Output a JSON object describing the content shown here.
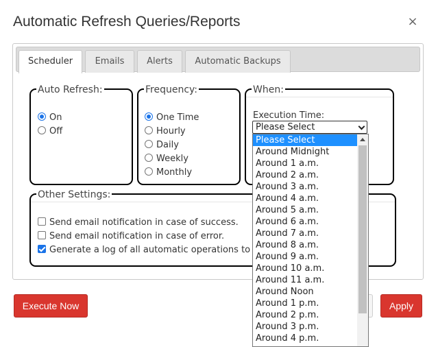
{
  "dialog": {
    "title": "Automatic Refresh Queries/Reports",
    "close_glyph": "×"
  },
  "tabs": [
    "Scheduler",
    "Emails",
    "Alerts",
    "Automatic Backups"
  ],
  "auto_refresh": {
    "legend": "Auto Refresh:",
    "options": [
      {
        "label": "On",
        "checked": true
      },
      {
        "label": "Off",
        "checked": false
      }
    ]
  },
  "frequency": {
    "legend": "Frequency:",
    "options": [
      {
        "label": "One Time",
        "checked": true
      },
      {
        "label": "Hourly",
        "checked": false
      },
      {
        "label": "Daily",
        "checked": false
      },
      {
        "label": "Weekly",
        "checked": false
      },
      {
        "label": "Monthly",
        "checked": false
      }
    ]
  },
  "when": {
    "legend": "When:",
    "execution_label": "Execution Time:",
    "selected_value": "Please Select",
    "options": [
      "Please Select",
      "Around Midnight",
      "Around 1 a.m.",
      "Around 2 a.m.",
      "Around 3 a.m.",
      "Around 4 a.m.",
      "Around 5 a.m.",
      "Around 6 a.m.",
      "Around 7 a.m.",
      "Around 8 a.m.",
      "Around 9 a.m.",
      "Around 10 a.m.",
      "Around 11 a.m.",
      "Around Noon",
      "Around 1 p.m.",
      "Around 2 p.m.",
      "Around 3 p.m.",
      "Around 4 p.m."
    ]
  },
  "other_settings": {
    "legend": "Other Settings:",
    "options": [
      {
        "label": "Send email notification in case of success.",
        "checked": false
      },
      {
        "label": "Send email notification in case of error.",
        "checked": false
      },
      {
        "label": "Generate a log of all automatic operations to",
        "checked": true
      }
    ]
  },
  "buttons": {
    "execute_now": "Execute Now",
    "apply": "Apply"
  },
  "colors": {
    "primary_red": "#d9362e",
    "selection_blue": "#1e90ff",
    "radio_blue": "#1a73e8"
  }
}
